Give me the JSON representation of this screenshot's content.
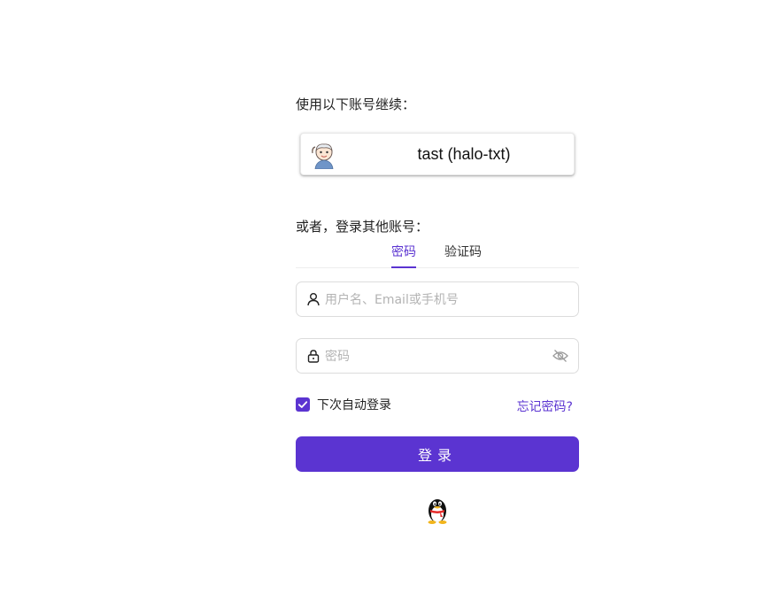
{
  "continue_section": {
    "label": "使用以下账号继续：",
    "account_name": "tast (halo-txt)"
  },
  "login_section": {
    "label": "或者，登录其他账号：",
    "tabs": [
      {
        "label": "密码",
        "active": true
      },
      {
        "label": "验证码",
        "active": false
      }
    ],
    "username_placeholder": "用户名、Email或手机号",
    "password_placeholder": "密码",
    "remember_label": "下次自动登录",
    "remember_checked": true,
    "forgot_label": "忘记密码?",
    "submit_label": "登录"
  },
  "icons": {
    "username": "user-icon",
    "password": "lock-icon",
    "toggle_visibility": "eye-off-icon",
    "social": "qq-penguin-icon"
  },
  "colors": {
    "accent": "#5b34d1",
    "border": "#dcdcdc",
    "placeholder": "#b3b3b3"
  }
}
